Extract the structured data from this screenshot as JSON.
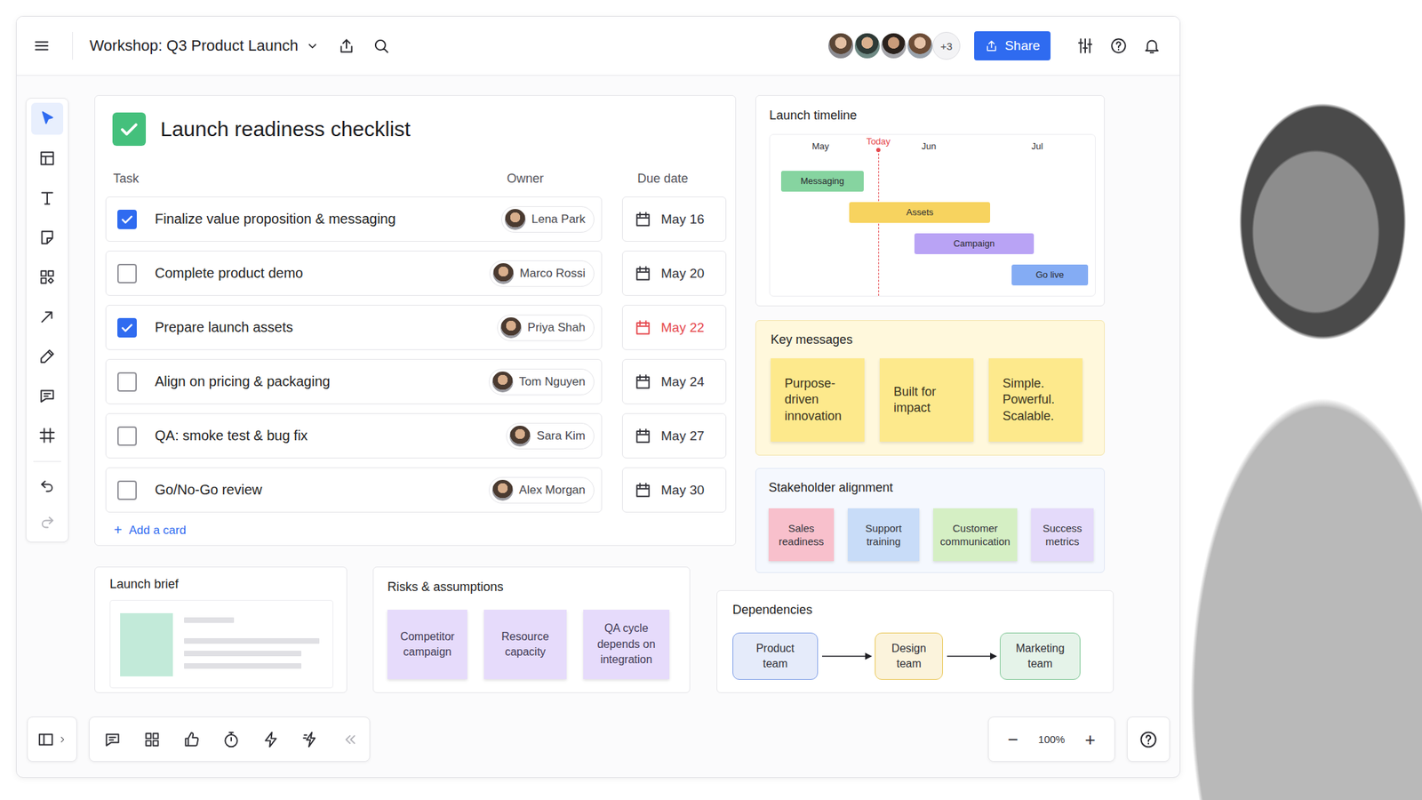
{
  "window": {
    "title": "Workshop: Q3 Product Launch"
  },
  "header": {
    "more_collaborators": "+3",
    "share_button": "Share"
  },
  "toolbar": {
    "tools": [
      {
        "kind": "select",
        "selected": true
      },
      {
        "kind": "template",
        "selected": false
      },
      {
        "kind": "text",
        "selected": false
      },
      {
        "kind": "sticky-note",
        "selected": false
      },
      {
        "kind": "shapes",
        "selected": false
      },
      {
        "kind": "connector",
        "selected": false
      },
      {
        "kind": "pen",
        "selected": false
      },
      {
        "kind": "comment",
        "selected": false
      },
      {
        "kind": "frame",
        "selected": false
      }
    ],
    "history": [
      {
        "kind": "undo",
        "disabled": false
      },
      {
        "kind": "redo",
        "disabled": true
      }
    ]
  },
  "checklist": {
    "title": "Launch readiness checklist",
    "columns": [
      "Task",
      "Owner",
      "Due date"
    ],
    "rows": [
      {
        "task": "Finalize value proposition & messaging",
        "owner": "Lena Park",
        "due": "May 16",
        "checked": true,
        "overdue": false
      },
      {
        "task": "Complete product demo",
        "owner": "Marco Rossi",
        "due": "May 20",
        "checked": false,
        "overdue": false
      },
      {
        "task": "Prepare launch assets",
        "owner": "Priya Shah",
        "due": "May 22",
        "checked": true,
        "overdue": true
      },
      {
        "task": "Align on pricing & packaging",
        "owner": "Tom Nguyen",
        "due": "May 24",
        "checked": false,
        "overdue": false
      },
      {
        "task": "QA: smoke test & bug fix",
        "owner": "Sara Kim",
        "due": "May 27",
        "checked": false,
        "overdue": false
      },
      {
        "task": "Go/No-Go review",
        "owner": "Alex Morgan",
        "due": "May 30",
        "checked": false,
        "overdue": false
      }
    ],
    "add_card": {
      "icon": "+",
      "label": "Add a card"
    }
  },
  "timeline": {
    "title": "Launch timeline",
    "axis_days": 90,
    "months": [
      {
        "label": "May",
        "day": 14
      },
      {
        "label": "Jun",
        "day": 44
      },
      {
        "label": "Jul",
        "day": 74
      }
    ],
    "today": {
      "label": "Today",
      "day": 30
    },
    "bars": [
      {
        "label": "Messaging",
        "start": 3,
        "end": 26,
        "color": "#86d4a0"
      },
      {
        "label": "Assets",
        "start": 22,
        "end": 61,
        "color": "#f7d35f"
      },
      {
        "label": "Campaign",
        "start": 40,
        "end": 73,
        "color": "#b9a3f5"
      },
      {
        "label": "Go live",
        "start": 67,
        "end": 88,
        "color": "#84acf4"
      }
    ]
  },
  "key_messages": {
    "title": "Key messages",
    "notes": [
      "Purpose-driven innovation",
      "Built for impact",
      "Simple. Powerful. Scalable."
    ]
  },
  "stakeholder_alignment": {
    "title": "Stakeholder alignment",
    "notes": [
      {
        "text": "Sales readiness",
        "color": "#f8c0cc"
      },
      {
        "text": "Support training",
        "color": "#c8dcf8"
      },
      {
        "text": "Customer communication",
        "color": "#d5efc4"
      },
      {
        "text": "Success metrics",
        "color": "#e4dafa"
      }
    ]
  },
  "launch_brief": {
    "title": "Launch brief"
  },
  "risks": {
    "title": "Risks & assumptions",
    "notes": [
      "Competitor campaign",
      "Resource capacity",
      "QA cycle depends on integration"
    ]
  },
  "dependencies": {
    "title": "Dependencies",
    "nodes": [
      {
        "label": "Product team",
        "color": "#7b9be6"
      },
      {
        "label": "Design team",
        "color": "#e9c552"
      },
      {
        "label": "Marketing team",
        "color": "#7cc592"
      }
    ]
  },
  "bottom_toolbar": {
    "panel_toggle": {
      "kind": "panel"
    },
    "tools": [
      {
        "kind": "comment"
      },
      {
        "kind": "grid"
      },
      {
        "kind": "like"
      },
      {
        "kind": "timer"
      },
      {
        "kind": "bolt"
      },
      {
        "kind": "bolt-alt"
      },
      {
        "kind": "collapse"
      }
    ]
  },
  "zoom": {
    "minus": "−",
    "level": "100%",
    "plus": "+"
  }
}
